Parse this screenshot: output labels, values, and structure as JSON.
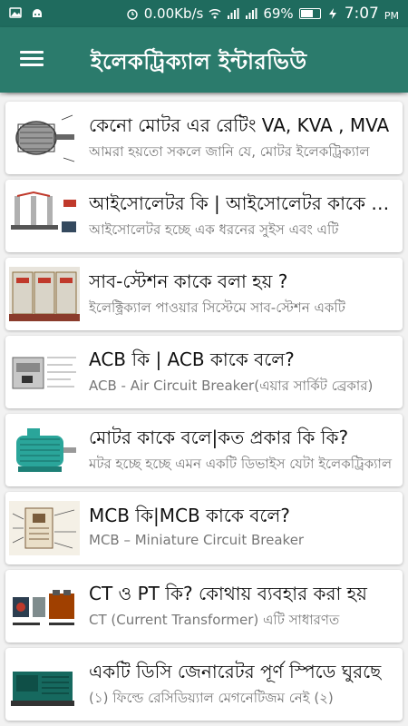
{
  "status_bar": {
    "network_speed": "0.00Kb/s",
    "battery_percent": "69%",
    "time": "7:07",
    "ampm": "PM",
    "battery_level": 0.69
  },
  "app_bar": {
    "title": "ইলেকট্রিক্যাল ইন্টারভিউ"
  },
  "articles": [
    {
      "title": "কেনো মোটর এর রেটিং VA, KVA , MVA",
      "subtitle": "আমরা হয়তো সকলে জানি যে, মোটর ইলেকট্রিক্যাল",
      "thumb": "motor-diagram"
    },
    {
      "title": "আইসোলেটর কি | আইসোলেটর কাকে বলে",
      "subtitle": "আইসোলেটর হচ্ছে এক ধরনের সুইস এবং এটি",
      "thumb": "isolator"
    },
    {
      "title": "সাব-স্টেশন কাকে বলা হয় ?",
      "subtitle": "ইলেক্ট্রিক্যাল পাওয়ার সিস্টেমে সাব-স্টেশন একটি",
      "thumb": "substation-panel"
    },
    {
      "title": "ACB কি | ACB কাকে বলে?",
      "subtitle": "ACB - Air Circuit Breaker(এয়ার সার্কিট ব্রেকার)",
      "thumb": "acb-breaker"
    },
    {
      "title": "মোটর কাকে বলে|কত প্রকার কি কি?",
      "subtitle": "মটর হচ্ছে হচ্ছে এমন একটি ডিভাইস যেটা ইলেকট্রিক্যাল",
      "thumb": "electric-motor"
    },
    {
      "title": "MCB কি|MCB কাকে বলে?",
      "subtitle": "MCB – Miniature Circuit Breaker",
      "thumb": "mcb-diagram"
    },
    {
      "title": "CT ও PT কি? কোথায় ব্যবহার করা হয়",
      "subtitle": "CT (Current Transformer) এটি সাধারণত",
      "thumb": "ct-pt"
    },
    {
      "title": "একটি ডিসি জেনারেটর পূর্ণ স্পিডে ঘুরছে",
      "subtitle": "(১) ফিল্ডে রেসিডিয়্যাল মেগনেটিজম নেই (২)",
      "thumb": "dc-generator"
    }
  ]
}
